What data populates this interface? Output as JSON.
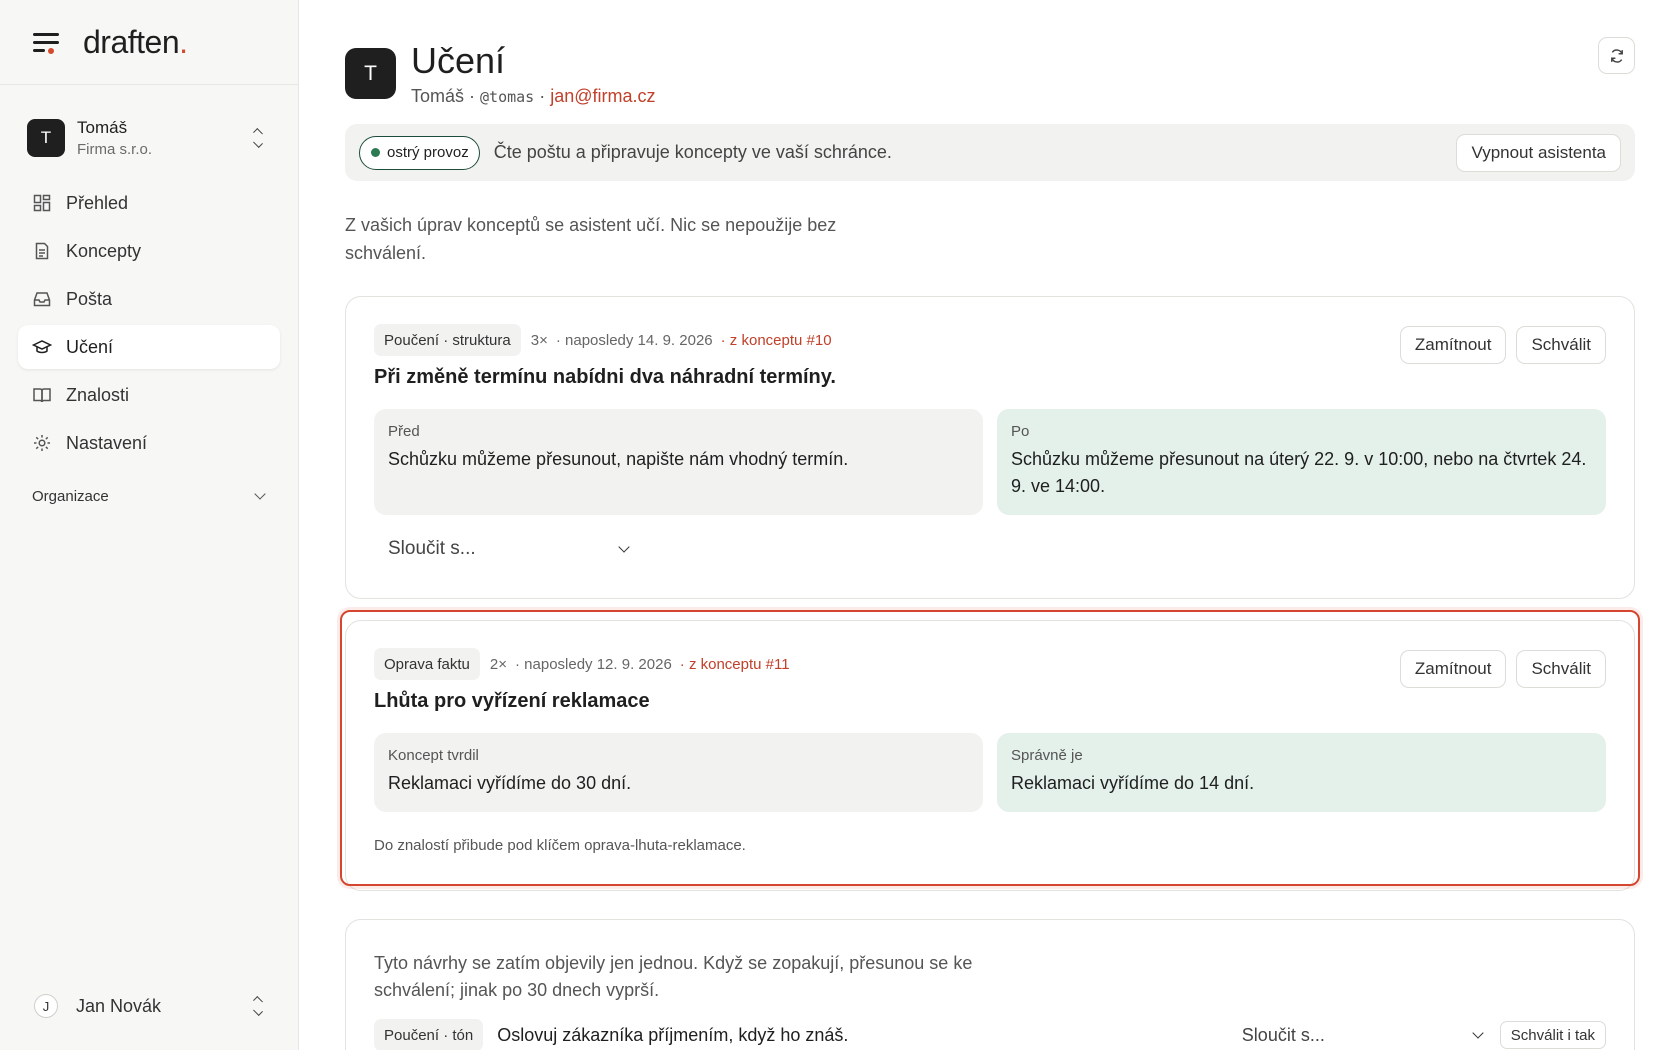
{
  "brand": {
    "name": "draften",
    "dot": "."
  },
  "account": {
    "initial": "T",
    "name": "Tomáš",
    "org": "Firma s.r.o."
  },
  "nav": [
    {
      "label": "Přehled",
      "icon": "grid-icon"
    },
    {
      "label": "Koncepty",
      "icon": "document-icon"
    },
    {
      "label": "Pošta",
      "icon": "inbox-icon"
    },
    {
      "label": "Učení",
      "icon": "graduation-cap-icon",
      "active": true
    },
    {
      "label": "Znalosti",
      "icon": "book-icon"
    },
    {
      "label": "Nastavení",
      "icon": "gear-icon"
    }
  ],
  "organization": {
    "label": "Organizace"
  },
  "user": {
    "initial": "J",
    "name": "Jan Novák"
  },
  "header": {
    "initial": "T",
    "title": "Učení",
    "name": "Tomáš",
    "sep1": " · ",
    "handle": "@tomas",
    "sep2": " · ",
    "email": "jan@firma.cz"
  },
  "status": {
    "badge": "ostrý provoz",
    "text": "Čte poštu a připravuje koncepty ve vaší schránce.",
    "button": "Vypnout asistenta"
  },
  "intro": "Z vašich úprav konceptů se asistent učí. Nic se nepoužije bez schválení.",
  "cards": [
    {
      "tag": "Poučení · struktura",
      "count": "3×",
      "last": "· naposledy 14. 9. 2026",
      "source": "· z konceptu #10",
      "title": "Při změně termínu nabídni dva náhradní termíny.",
      "left_label": "Před",
      "left_text": "Schůzku můžeme přesunout, napište nám vhodný termín.",
      "right_label": "Po",
      "right_text": "Schůzku můžeme přesunout na úterý 22. 9. v 10:00, nebo na čtvrtek 24. 9. ve 14:00.",
      "merge_placeholder": "Sloučit s...",
      "reject": "Zamítnout",
      "approve": "Schválit"
    },
    {
      "tag": "Oprava faktu",
      "count": "2×",
      "last": "· naposledy 12. 9. 2026",
      "source": "· z konceptu #11",
      "title": "Lhůta pro vyřízení reklamace",
      "left_label": "Koncept tvrdil",
      "left_text": "Reklamaci vyřídíme do 30 dní.",
      "right_label": "Správně je",
      "right_text": "Reklamaci vyřídíme do 14 dní.",
      "note": "Do znalostí přibude pod klíčem oprava-lhuta-reklamace.",
      "reject": "Zamítnout",
      "approve": "Schválit"
    }
  ],
  "pending": {
    "text": "Tyto návrhy se zatím objevily jen jednou. Když se zopakují, přesunou se ke schválení; jinak po 30 dnech vyprší.",
    "item": {
      "tag": "Poučení · tón",
      "text": "Oslovuj zákazníka příjmením, když ho znáš.",
      "merge_placeholder": "Sloučit s...",
      "approve": "Schválit i tak"
    }
  },
  "colors": {
    "accent": "#d44a2c",
    "link": "#c0402a",
    "live": "#2a7a52",
    "after_bg": "#e4f0ea",
    "before_bg": "#f2f2f0"
  }
}
